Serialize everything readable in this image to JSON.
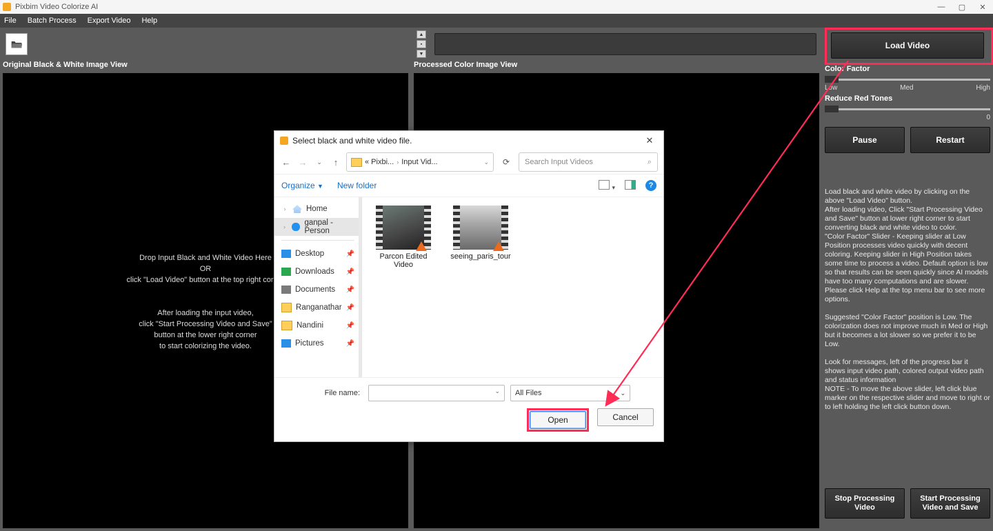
{
  "title": "Pixbim Video Colorize AI",
  "menu": {
    "file": "File",
    "batch": "Batch Process",
    "export": "Export Video",
    "help": "Help"
  },
  "views": {
    "left_label": "Original Black & White Image View",
    "right_label": "Processed Color Image View",
    "drop_msg_l1": "Drop Input Black and White Video Here",
    "drop_msg_l2": "OR",
    "drop_msg_l3": "click \"Load Video\" button at the top right corner",
    "drop_msg_l4": "After loading the input video,",
    "drop_msg_l5": "click \"Start Processing Video and Save\"",
    "drop_msg_l6": "button at the lower right corner",
    "drop_msg_l7": "to start colorizing the video."
  },
  "side": {
    "load_video": "Load Video",
    "color_factor": "Color Factor",
    "cf_low": "Low",
    "cf_med": "Med",
    "cf_high": "High",
    "reduce_red": "Reduce Red Tones",
    "rr_min": "",
    "rr_max": "0",
    "pause": "Pause",
    "restart": "Restart",
    "info": "Load black and white video by clicking on the above \"Load Video\" button.\nAfter loading video, Click \"Start Processing Video and Save\" button at lower right corner to start converting black and white video to color.\n\"Color Factor\" Slider - Keeping slider at Low Position processes video quickly with decent coloring. Keeping slider in High Position takes some time to process a video. Default option is low so that results can be seen quickly since AI models have too many computations and are slower.\nPlease click Help at the top menu bar to see more options.\n\nSuggested \"Color Factor\" position is Low. The colorization does not improve much in Med or High but it becomes a lot slower so we prefer it to be Low.\n\nLook for messages, left of the progress bar it shows input video path, colored output video path and status information\nNOTE - To move the above slider, left click blue marker on the respective slider and move to right or to left holding the left click button down.",
    "stop": "Stop Processing\nVideo",
    "start": "Start Processing\nVideo and Save"
  },
  "dialog": {
    "title": "Select black and white video file.",
    "crumb1": "« Pixbi...",
    "crumb2": "Input Vid...",
    "search_placeholder": "Search Input Videos",
    "organize": "Organize",
    "new_folder": "New folder",
    "nav": {
      "home": "Home",
      "personal": "ganpal - Person",
      "desktop": "Desktop",
      "downloads": "Downloads",
      "documents": "Documents",
      "folder1": "Ranganathar",
      "folder2": "Nandini",
      "pictures": "Pictures"
    },
    "files": [
      {
        "name": "Parcon Edited Video"
      },
      {
        "name": "seeing_paris_tour"
      }
    ],
    "file_name_label": "File name:",
    "filter": "All Files",
    "open": "Open",
    "cancel": "Cancel"
  }
}
